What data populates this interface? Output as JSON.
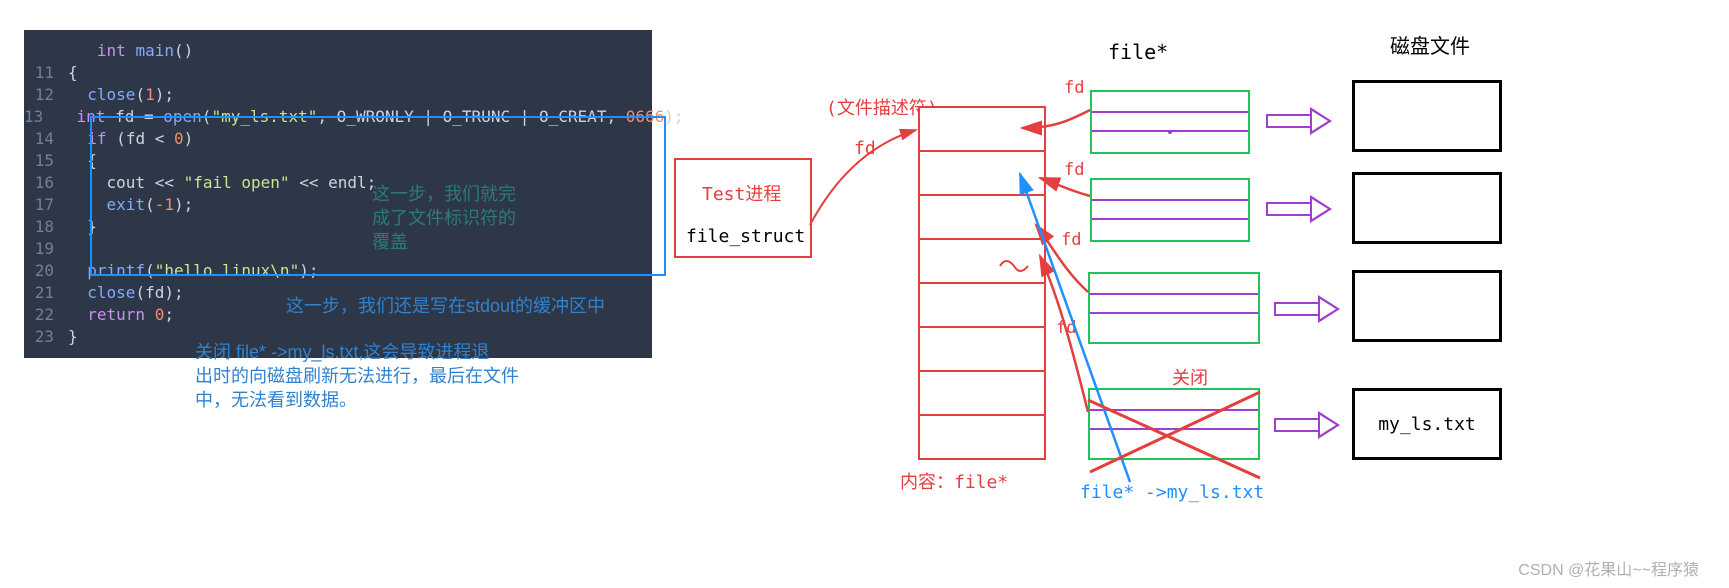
{
  "code": {
    "lines": [
      {
        "no": "",
        "text_key": "l0"
      },
      {
        "no": "11",
        "text_key": "l11"
      },
      {
        "no": "12",
        "text_key": "l12"
      },
      {
        "no": "13",
        "text_key": "l13"
      },
      {
        "no": "14",
        "text_key": "l14"
      },
      {
        "no": "15",
        "text_key": "l15"
      },
      {
        "no": "16",
        "text_key": "l16"
      },
      {
        "no": "17",
        "text_key": "l17"
      },
      {
        "no": "18",
        "text_key": "l18"
      },
      {
        "no": "19",
        "text_key": "l19"
      },
      {
        "no": "20",
        "text_key": "l20"
      },
      {
        "no": "21",
        "text_key": "l21"
      },
      {
        "no": "22",
        "text_key": "l22"
      },
      {
        "no": "23",
        "text_key": "l23"
      }
    ],
    "tokens": {
      "int": "int",
      "main": "main",
      "close": "close",
      "open": "open",
      "if": "if",
      "cout": "cout",
      "endl": "endl",
      "exit": "exit",
      "printf": "printf",
      "return": "return",
      "fd": "fd",
      "num1": "1",
      "numNeg1": "-1",
      "num0": "0",
      "num0666": "0666",
      "str_myls": "\"my_ls.txt\"",
      "str_fail": "\"fail open\"",
      "str_hello": "\"hello linux\\n\"",
      "o_wronly": "O_WRONLY",
      "o_trunc": "O_TRUNC",
      "o_creat": "O_CREAT"
    }
  },
  "annotations": {
    "box1": "这一步，我们就完\n成了文件标识符的\n覆盖",
    "stdout": "这一步，我们还是写在stdout的缓冲区中",
    "closefd": "关闭 file* ->my_ls.txt,这会导致进程退\n出时的向磁盘刷新无法进行，最后在文件\n中，无法看到数据。"
  },
  "diagram": {
    "header_filestar": "file*",
    "header_disk": "磁盘文件",
    "fd_descriptor": "(文件描述符)",
    "fd_label": "fd",
    "test_proc": "Test进程",
    "file_struct": "file_struct",
    "content_filestar": "内容：file*",
    "fd_small": "fd",
    "close_label": "关闭",
    "myls_filestar": "file*  ->my_ls.txt",
    "disk_file_label": "my_ls.txt"
  },
  "watermark": "CSDN @花果山~~程序猿"
}
